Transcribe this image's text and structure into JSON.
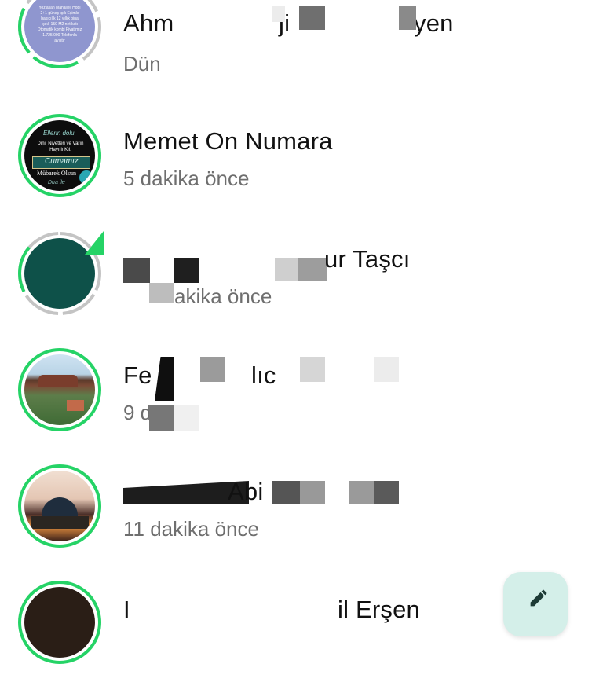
{
  "status_list": {
    "items": [
      {
        "name": "Ahm",
        "name_tail": "ji",
        "name_end": "yen",
        "time": "Dün"
      },
      {
        "name": "Memet On Numara",
        "time": "5 dakika önce"
      },
      {
        "name": "ur Taşcı",
        "time": "akika önce"
      },
      {
        "name": "Fe",
        "name_tail": "lıc",
        "time": "9 d"
      },
      {
        "name": "Abi",
        "time": "11 dakika önce"
      },
      {
        "name": "I",
        "name_tail": "il Erşen",
        "time": ""
      }
    ]
  },
  "avatars": {
    "item0_text": "Yozlaşan Mahalleli Hobi 2+1 güneş ışık Eşimle bakıcılık 12 yıllık bina ışıklı 150 M2 net katı Otomatik kombi Fiyatımız 1.725.000 Telefonla ayıştır",
    "item1_top": "Ellerin dolu",
    "item1_mid": "Dini, Niyetleri ve Varın Hayırlı Kıl.",
    "item1_script": "Cumamız",
    "item1_bottom": "Mübarek Olsun",
    "item1_sign": "Dua ile"
  },
  "colors": {
    "accent": "#25d366",
    "seen_ring": "#c4c4c4",
    "fab_bg": "#d4efe9",
    "text_primary": "#111111",
    "text_secondary": "#6e6e6e"
  },
  "icons": {
    "fab": "pencil-icon"
  }
}
